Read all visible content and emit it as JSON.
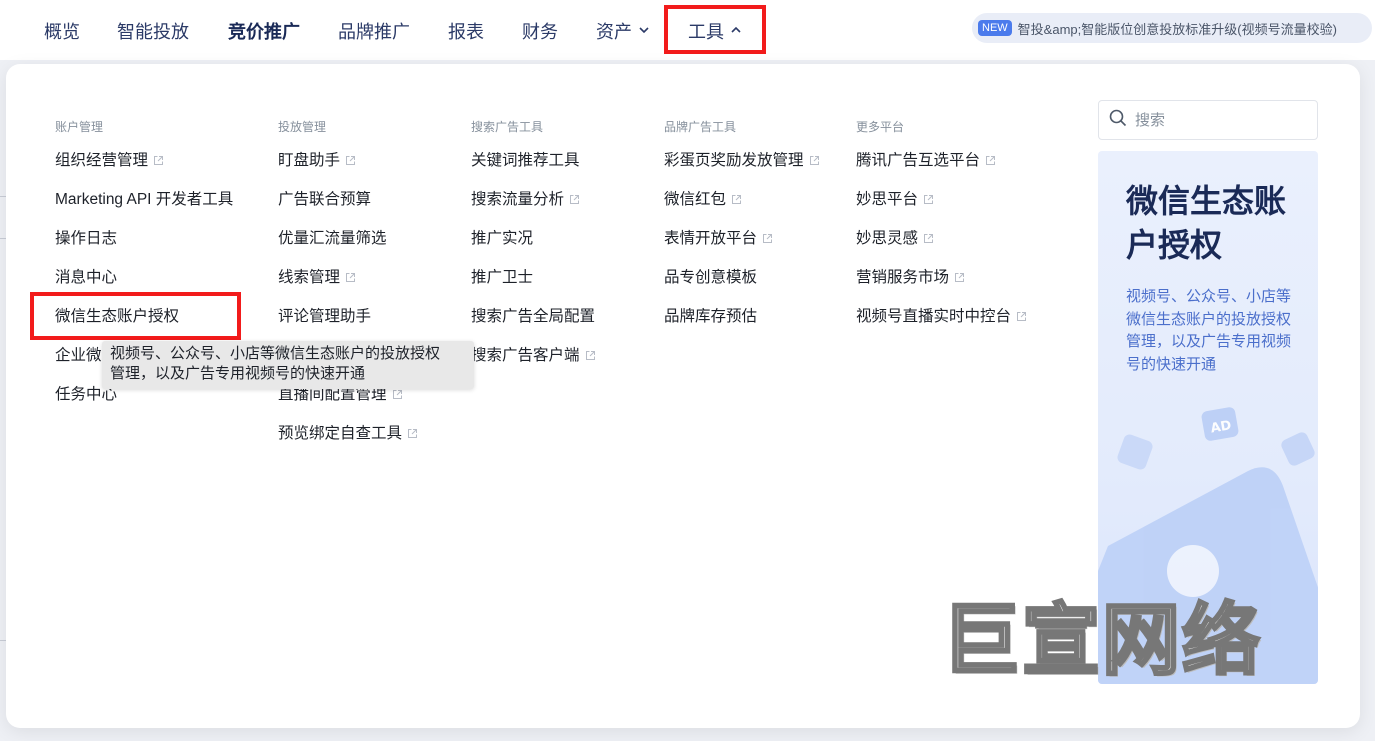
{
  "nav": {
    "items": [
      {
        "label": "概览"
      },
      {
        "label": "智能投放"
      },
      {
        "label": "竞价推广"
      },
      {
        "label": "品牌推广"
      },
      {
        "label": "报表"
      },
      {
        "label": "财务"
      },
      {
        "label": "资产"
      },
      {
        "label": "工具"
      }
    ],
    "announcement": {
      "badge": "NEW",
      "text": "智投&amp;智能版位创意投放标准升级(视频号流量校验)"
    }
  },
  "menu": {
    "columns": [
      {
        "title": "账户管理",
        "items": [
          {
            "label": "组织经营管理",
            "external": true
          },
          {
            "label": "Marketing API 开发者工具",
            "external": false
          },
          {
            "label": "操作日志",
            "external": false
          },
          {
            "label": "消息中心",
            "external": false
          },
          {
            "label": "微信生态账户授权",
            "external": false
          },
          {
            "label": "企业微",
            "external": false
          },
          {
            "label": "任务中心",
            "external": false
          }
        ]
      },
      {
        "title": "投放管理",
        "items": [
          {
            "label": "盯盘助手",
            "external": true
          },
          {
            "label": "广告联合预算",
            "external": false
          },
          {
            "label": "优量汇流量筛选",
            "external": false
          },
          {
            "label": "线索管理",
            "external": true
          },
          {
            "label": "评论管理助手",
            "external": false
          },
          {
            "label": "",
            "external": false
          },
          {
            "label": "直播间配置管理",
            "external": true
          },
          {
            "label": "预览绑定自查工具",
            "external": true
          }
        ]
      },
      {
        "title": "搜索广告工具",
        "items": [
          {
            "label": "关键词推荐工具",
            "external": false
          },
          {
            "label": "搜索流量分析",
            "external": true
          },
          {
            "label": "推广实况",
            "external": false
          },
          {
            "label": "推广卫士",
            "external": false
          },
          {
            "label": "搜索广告全局配置",
            "external": false
          },
          {
            "label": "搜索广告客户端",
            "external": true
          }
        ]
      },
      {
        "title": "品牌广告工具",
        "items": [
          {
            "label": "彩蛋页奖励发放管理",
            "external": true
          },
          {
            "label": "微信红包",
            "external": true
          },
          {
            "label": "表情开放平台",
            "external": true
          },
          {
            "label": "品专创意模板",
            "external": false
          },
          {
            "label": "品牌库存预估",
            "external": false
          }
        ]
      },
      {
        "title": "更多平台",
        "items": [
          {
            "label": "腾讯广告互选平台",
            "external": true
          },
          {
            "label": "妙思平台",
            "external": true
          },
          {
            "label": "妙思灵感",
            "external": true
          },
          {
            "label": "营销服务市场",
            "external": true
          },
          {
            "label": "视频号直播实时中控台",
            "external": true
          }
        ]
      }
    ],
    "tooltip": {
      "line1": "视频号、公众号、小店等微信生态账户的投放授权",
      "line2": "管理，以及广告专用视频号的快速开通"
    },
    "search": {
      "placeholder": "搜索",
      "value": ""
    },
    "promo": {
      "title": "微信生态账户授权",
      "description": "视频号、公众号、小店等微信生态账户的投放授权管理，以及广告专用视频号的快速开通"
    }
  },
  "watermark": "巨宣网络",
  "colors": {
    "accent": "#4b7bec",
    "highlight": "#f21b1b",
    "nav_text": "#2b3a67"
  }
}
